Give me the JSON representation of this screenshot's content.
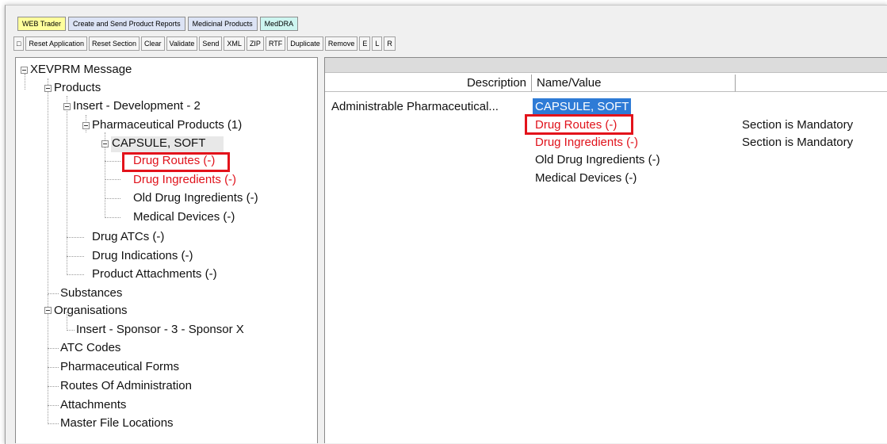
{
  "tabs": [
    {
      "label": "WEB Trader",
      "color": "#ffff9c"
    },
    {
      "label": "Create and Send Product Reports",
      "color": "#dce3f5"
    },
    {
      "label": "Medicinal Products",
      "color": "#dce3f5"
    },
    {
      "label": "MedDRA",
      "color": "#cdf5f0"
    }
  ],
  "toolbar": {
    "buttons": [
      "□",
      "Reset Application",
      "Reset Section",
      "Clear",
      "Validate",
      "Send",
      "XML",
      "ZIP",
      "RTF",
      "Duplicate",
      "Remove",
      "E",
      "L",
      "R"
    ]
  },
  "tree": {
    "root": "XEVPRM Message",
    "products": "Products",
    "insert_dev": "Insert - Development - 2",
    "pharm_products": "Pharmaceutical Products (1)",
    "capsule": "CAPSULE, SOFT",
    "drug_routes": "Drug Routes (-)",
    "drug_ingredients": "Drug Ingredients (-)",
    "old_drug_ingredients": "Old Drug Ingredients (-)",
    "medical_devices": "Medical Devices (-)",
    "drug_atcs": "Drug ATCs (-)",
    "drug_indications": "Drug Indications (-)",
    "product_attachments": "Product Attachments (-)",
    "substances": "Substances",
    "organisations": "Organisations",
    "insert_sponsor": "Insert - Sponsor - 3 - Sponsor X",
    "atc_codes": "ATC Codes",
    "pharm_forms": "Pharmaceutical Forms",
    "routes_admin": "Routes Of Administration",
    "attachments": "Attachments",
    "master_file": "Master File Locations"
  },
  "table": {
    "headers": [
      "Description",
      "Name/Value",
      ""
    ],
    "description": "Administrable Pharmaceutical...",
    "rows": [
      {
        "value": "CAPSULE, SOFT",
        "note": ""
      },
      {
        "value": "Drug Routes (-)",
        "note": "Section is Mandatory"
      },
      {
        "value": "Drug Ingredients (-)",
        "note": "Section is Mandatory"
      },
      {
        "value": "Old Drug Ingredients (-)",
        "note": ""
      },
      {
        "value": "Medical Devices (-)",
        "note": ""
      }
    ]
  },
  "colors": {
    "mandatory_red": "#e0121b",
    "highlight_red": "#e3131b",
    "selection_blue": "#2e7bd6"
  }
}
